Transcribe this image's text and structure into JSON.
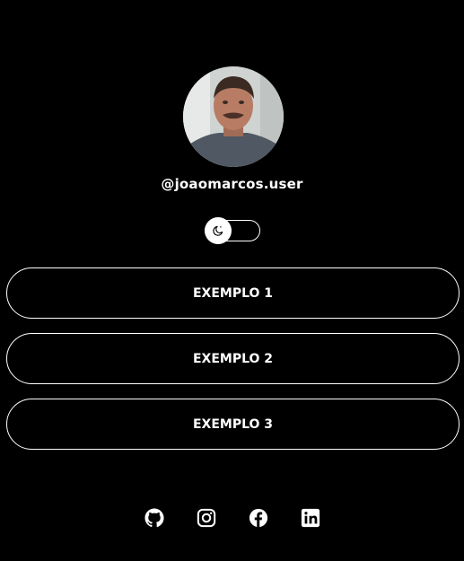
{
  "profile": {
    "username": "@joaomarcos.user",
    "avatar_icon": "profile-photo"
  },
  "theme_toggle": {
    "icon": "moon-icon",
    "state": "off"
  },
  "links": [
    {
      "label": "EXEMPLO 1"
    },
    {
      "label": "EXEMPLO 2"
    },
    {
      "label": "EXEMPLO 3"
    }
  ],
  "socials": [
    {
      "name": "github",
      "icon": "github-icon"
    },
    {
      "name": "instagram",
      "icon": "instagram-icon"
    },
    {
      "name": "facebook",
      "icon": "facebook-icon"
    },
    {
      "name": "linkedin",
      "icon": "linkedin-icon"
    }
  ],
  "colors": {
    "background": "#000000",
    "foreground": "#ffffff"
  }
}
